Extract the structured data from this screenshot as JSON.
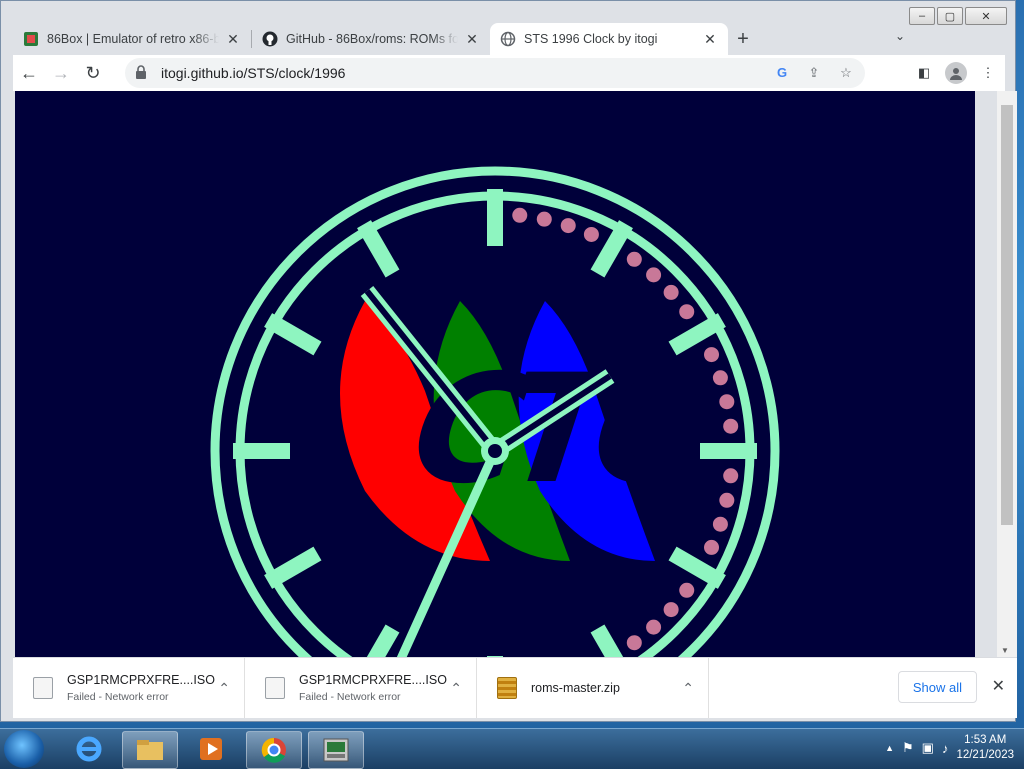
{
  "tabs": [
    {
      "title": "86Box | Emulator of retro x86-based",
      "close": "✕"
    },
    {
      "title": "GitHub - 86Box/roms: ROMs for the",
      "close": "✕"
    },
    {
      "title": "STS 1996 Clock by itogi",
      "close": "✕"
    }
  ],
  "newtab": "+",
  "tab_menu": "⌄",
  "window_controls": {
    "minimize": "–",
    "maximize": "▢",
    "close": "✕"
  },
  "toolbar": {
    "back": "←",
    "forward": "→",
    "reload": "↻"
  },
  "address": {
    "url": "itogi.github.io/STS/clock/1996"
  },
  "omni_icons": [
    "google-icon",
    "share-icon",
    "star-icon"
  ],
  "omni_glyphs": {
    "google": "G",
    "share": "⇪",
    "star": "☆"
  },
  "toolbar_right": {
    "sidepanel": "◧",
    "menu": "⋮"
  },
  "clock_face": {
    "colors": {
      "bg": "#00003a",
      "ring": "#8ef5c0",
      "dots": "#c87898",
      "red": "#ff0000",
      "green": "#008000",
      "blue": "#0000ff"
    },
    "letters": [
      "C",
      "T",
      "C"
    ]
  },
  "downloads": [
    {
      "name": "GSP1RMCPRXFRE....ISO",
      "status": "Failed - Network error",
      "type": "iso"
    },
    {
      "name": "GSP1RMCPRXFRE....ISO",
      "status": "Failed - Network error",
      "type": "iso"
    },
    {
      "name": "roms-master.zip",
      "status": "",
      "type": "zip"
    }
  ],
  "shelf": {
    "show_all": "Show all",
    "close": "✕",
    "chevron": "⌃"
  },
  "taskbar": {
    "time": "1:53 AM",
    "date": "12/21/2023"
  }
}
